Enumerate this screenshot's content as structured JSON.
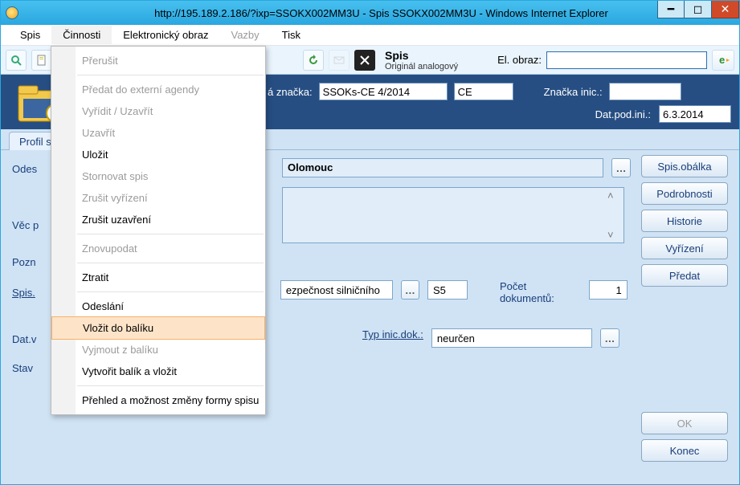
{
  "window": {
    "title": "http://195.189.2.186/?ixp=SSOKX002MM3U - Spis SSOKX002MM3U - Windows Internet Explorer"
  },
  "menubar": {
    "items": [
      "Spis",
      "Činnosti",
      "Elektronický obraz",
      "Vazby",
      "Tisk"
    ],
    "open_index": 1,
    "disabled_index": 3
  },
  "toolbar": {
    "title": "Spis",
    "subtitle": "Originál analogový",
    "el_obraz_label": "El. obraz:",
    "el_obraz_value": ""
  },
  "header": {
    "znacka_label": "á značka:",
    "znacka_value": "SSOKs-CE 4/2014",
    "ce_value": "CE",
    "znacka_inic_label": "Značka inic.:",
    "znacka_inic_value": "",
    "dat_pod_ini_label": "Dat.pod.ini.:",
    "dat_pod_ini_value": "6.3.2014"
  },
  "tabs": {
    "profil": "Profil s"
  },
  "form": {
    "odes_label": "Odes",
    "odes_value": "Olomouc",
    "vec_label": "Věc p",
    "pozn_label": "Pozn",
    "spis_label": "Spis.",
    "spis_field1": "ezpečnost silničního",
    "spis_s5": "S5",
    "pocet_dok_label": "Počet dokumentů:",
    "pocet_dok_value": "1",
    "datv_label": "Dat.v",
    "stav_label": "Stav",
    "typ_inic_label": "Typ inic.dok.:",
    "typ_inic_value": "neurčen"
  },
  "buttons": {
    "spis_obalka": "Spis.obálka",
    "podrobnosti": "Podrobnosti",
    "historie": "Historie",
    "vyrizeni": "Vyřízení",
    "predat": "Předat",
    "ok": "OK",
    "konec": "Konec"
  },
  "menu": {
    "prerusit": "Přerušit",
    "predat_ext": "Předat do externí agendy",
    "vyridit_uzavrit": "Vyřídit / Uzavřít",
    "uzavrit": "Uzavřít",
    "ulozit": "Uložit",
    "stornovat": "Stornovat spis",
    "zrusit_vyrizeni": "Zrušit vyřízení",
    "zrusit_uzavreni": "Zrušit uzavření",
    "znovupodat": "Znovupodat",
    "ztratit": "Ztratit",
    "odeslani": "Odeslání",
    "vlozit_do_baliku": "Vložit do balíku",
    "vyjmout_z_baliku": "Vyjmout z balíku",
    "vytvorit_balik": "Vytvořit balík a vložit",
    "prehled_formy": "Přehled a možnost změny formy spisu"
  }
}
